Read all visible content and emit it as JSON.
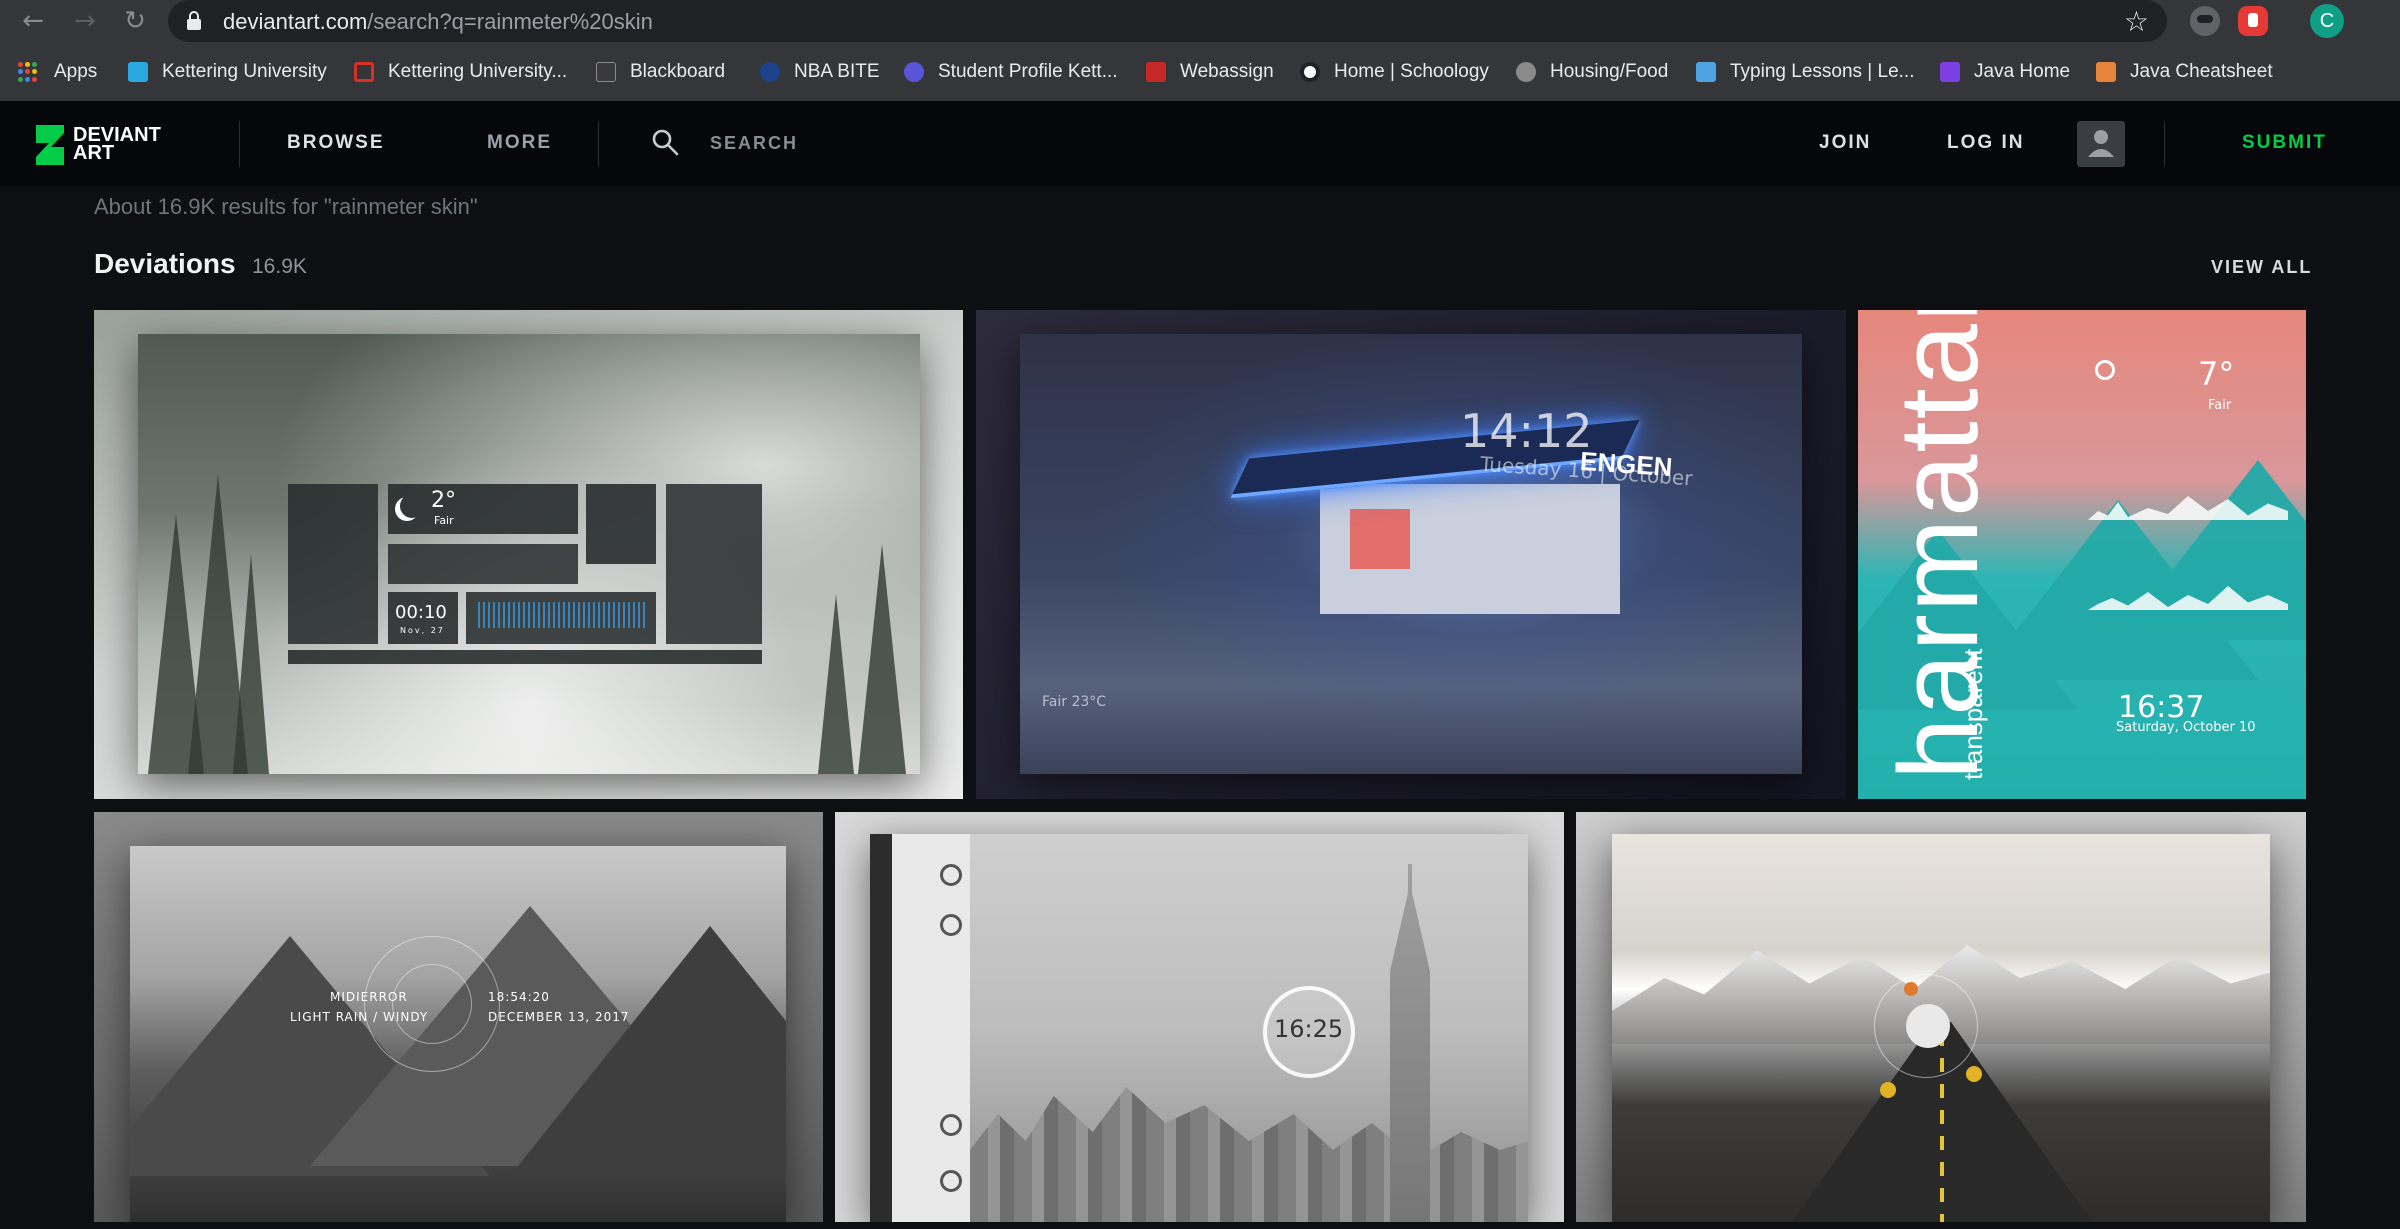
{
  "browser": {
    "url_host": "deviantart.com",
    "url_path": "/search?q=rainmeter%20skin",
    "profile_initial": "C",
    "bookmarks": [
      {
        "label": "Apps",
        "icon": "apps-grid-icon"
      },
      {
        "label": "Kettering University",
        "icon": "kettering-icon"
      },
      {
        "label": "Kettering University...",
        "icon": "gmail-icon"
      },
      {
        "label": "Blackboard",
        "icon": "blackboard-icon"
      },
      {
        "label": "NBA BITE",
        "icon": "nba-icon"
      },
      {
        "label": "Student Profile Kett...",
        "icon": "student-profile-icon"
      },
      {
        "label": "Webassign",
        "icon": "webassign-icon"
      },
      {
        "label": "Home | Schoology",
        "icon": "schoology-icon"
      },
      {
        "label": "Housing/Food",
        "icon": "housing-icon"
      },
      {
        "label": "Typing Lessons | Le...",
        "icon": "typing-icon"
      },
      {
        "label": "Java Home",
        "icon": "java-home-icon"
      },
      {
        "label": "Java Cheatsheet",
        "icon": "java-cheatsheet-icon"
      }
    ]
  },
  "header": {
    "logo_line1": "DEVIANT",
    "logo_line2": "ART",
    "browse": "BROWSE",
    "more": "MORE",
    "search": "SEARCH",
    "join": "JOIN",
    "login": "LOG IN",
    "submit": "SUBMIT"
  },
  "results": {
    "summary": "About 16.9K results for \"rainmeter skin\"",
    "section_title": "Deviations",
    "section_count": "16.9K",
    "view_all": "VIEW ALL"
  },
  "thumbs": {
    "t1": {
      "temp": "2°",
      "cond": "Fair",
      "time": "00:10",
      "date": "Nov, 27"
    },
    "t2": {
      "time": "14:12",
      "date": "Tuesday 16 | October",
      "brand": "ENGEN",
      "weather": "Fair 23°C"
    },
    "t3": {
      "title": "harmattan",
      "subtitle": "transparent",
      "temp": "7°",
      "cond": "Fair",
      "clock": "16:37",
      "date": "Saturday, October 10"
    },
    "t4": {
      "title": "MIDIERROR",
      "weather": "LIGHT RAIN / WINDY",
      "time": "18:54:20",
      "date": "DECEMBER 13, 2017"
    },
    "t5": {
      "clock": "16:25"
    },
    "t6": {}
  },
  "colors": {
    "submit": "#05cc47",
    "background": "#0d0f12",
    "header_bg": "#06070a"
  }
}
